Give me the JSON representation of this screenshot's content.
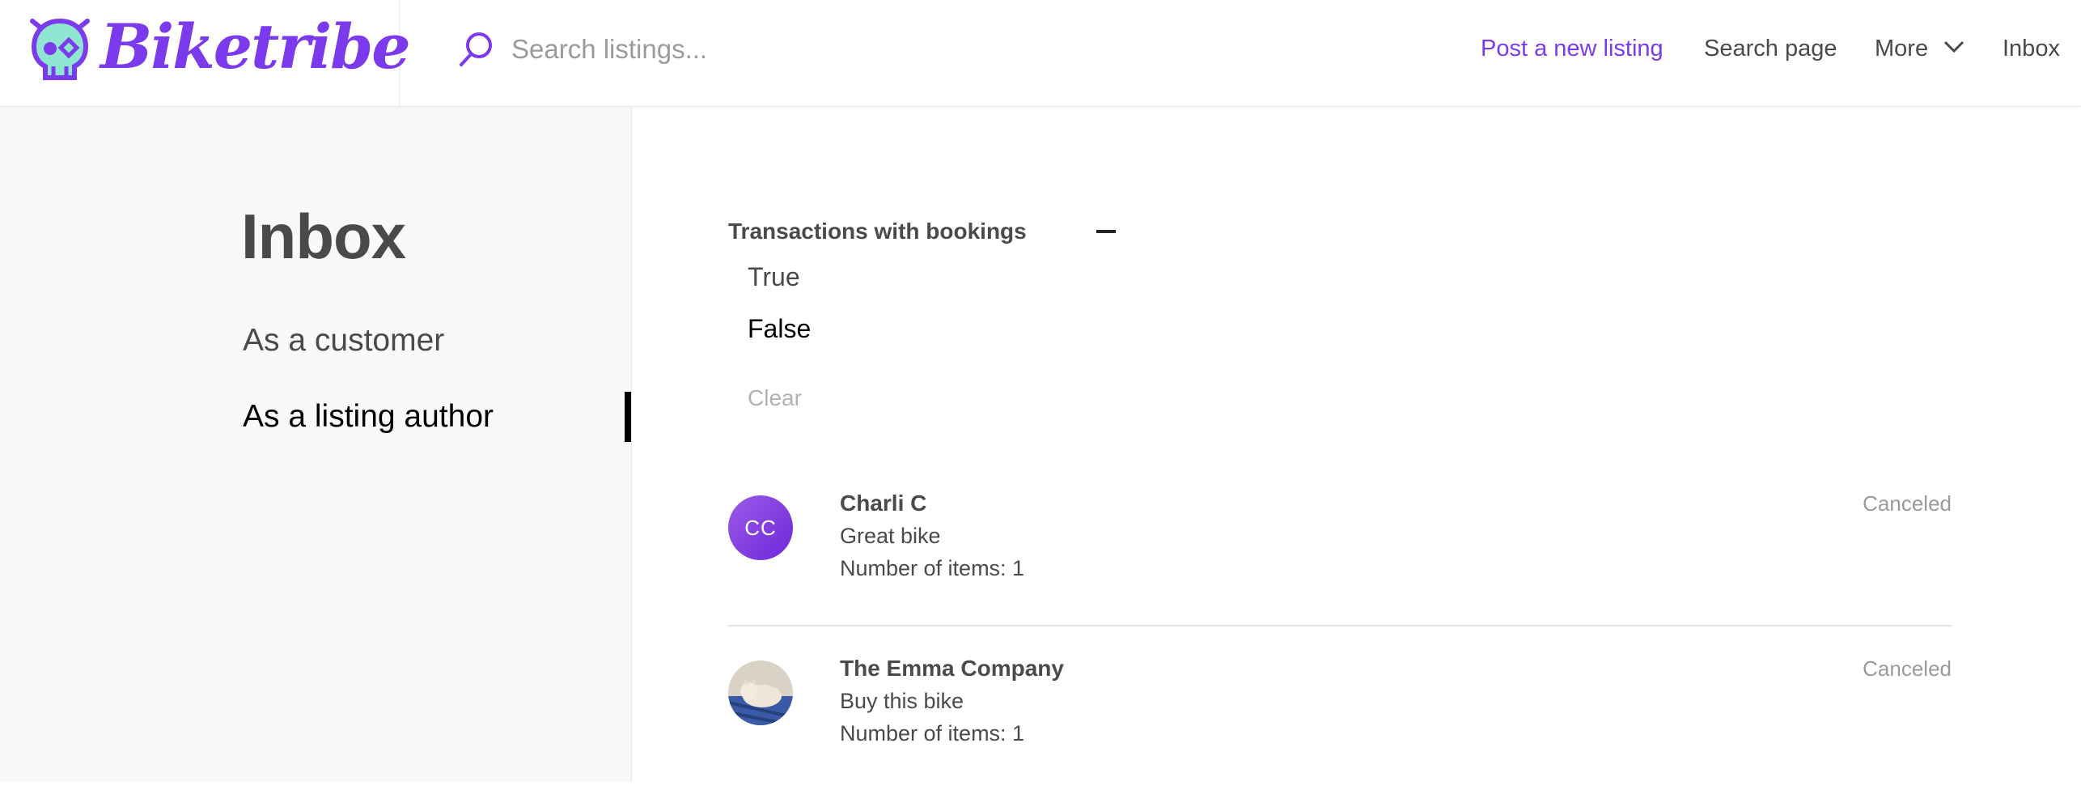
{
  "header": {
    "logo_text": "Biketribe",
    "search": {
      "placeholder": "Search listings...",
      "value": ""
    },
    "nav": {
      "post_listing": "Post a new listing",
      "search_page": "Search page",
      "more": "More",
      "inbox": "Inbox"
    }
  },
  "colors": {
    "brand": "#7c3aed",
    "logo_skull": "#8ee6d1",
    "text": "#4a4a4a",
    "muted": "#9b9b9b",
    "sidebar_bg": "#f9f9f9"
  },
  "sidebar": {
    "title": "Inbox",
    "tabs": [
      {
        "label": "As a customer",
        "selected": false
      },
      {
        "label": "As a listing author",
        "selected": true
      }
    ]
  },
  "filter": {
    "label": "Transactions with bookings",
    "options": [
      {
        "label": "True",
        "selected": false
      },
      {
        "label": "False",
        "selected": true
      }
    ],
    "clear_label": "Clear"
  },
  "transactions": [
    {
      "avatar_initials": "CC",
      "name": "Charli C",
      "title": "Great bike",
      "items": "Number of items: 1",
      "status": "Canceled"
    },
    {
      "avatar_icon": "profile-photo-cat",
      "name": "The Emma Company",
      "title": "Buy this bike",
      "items": "Number of items: 1",
      "status": "Canceled"
    }
  ]
}
